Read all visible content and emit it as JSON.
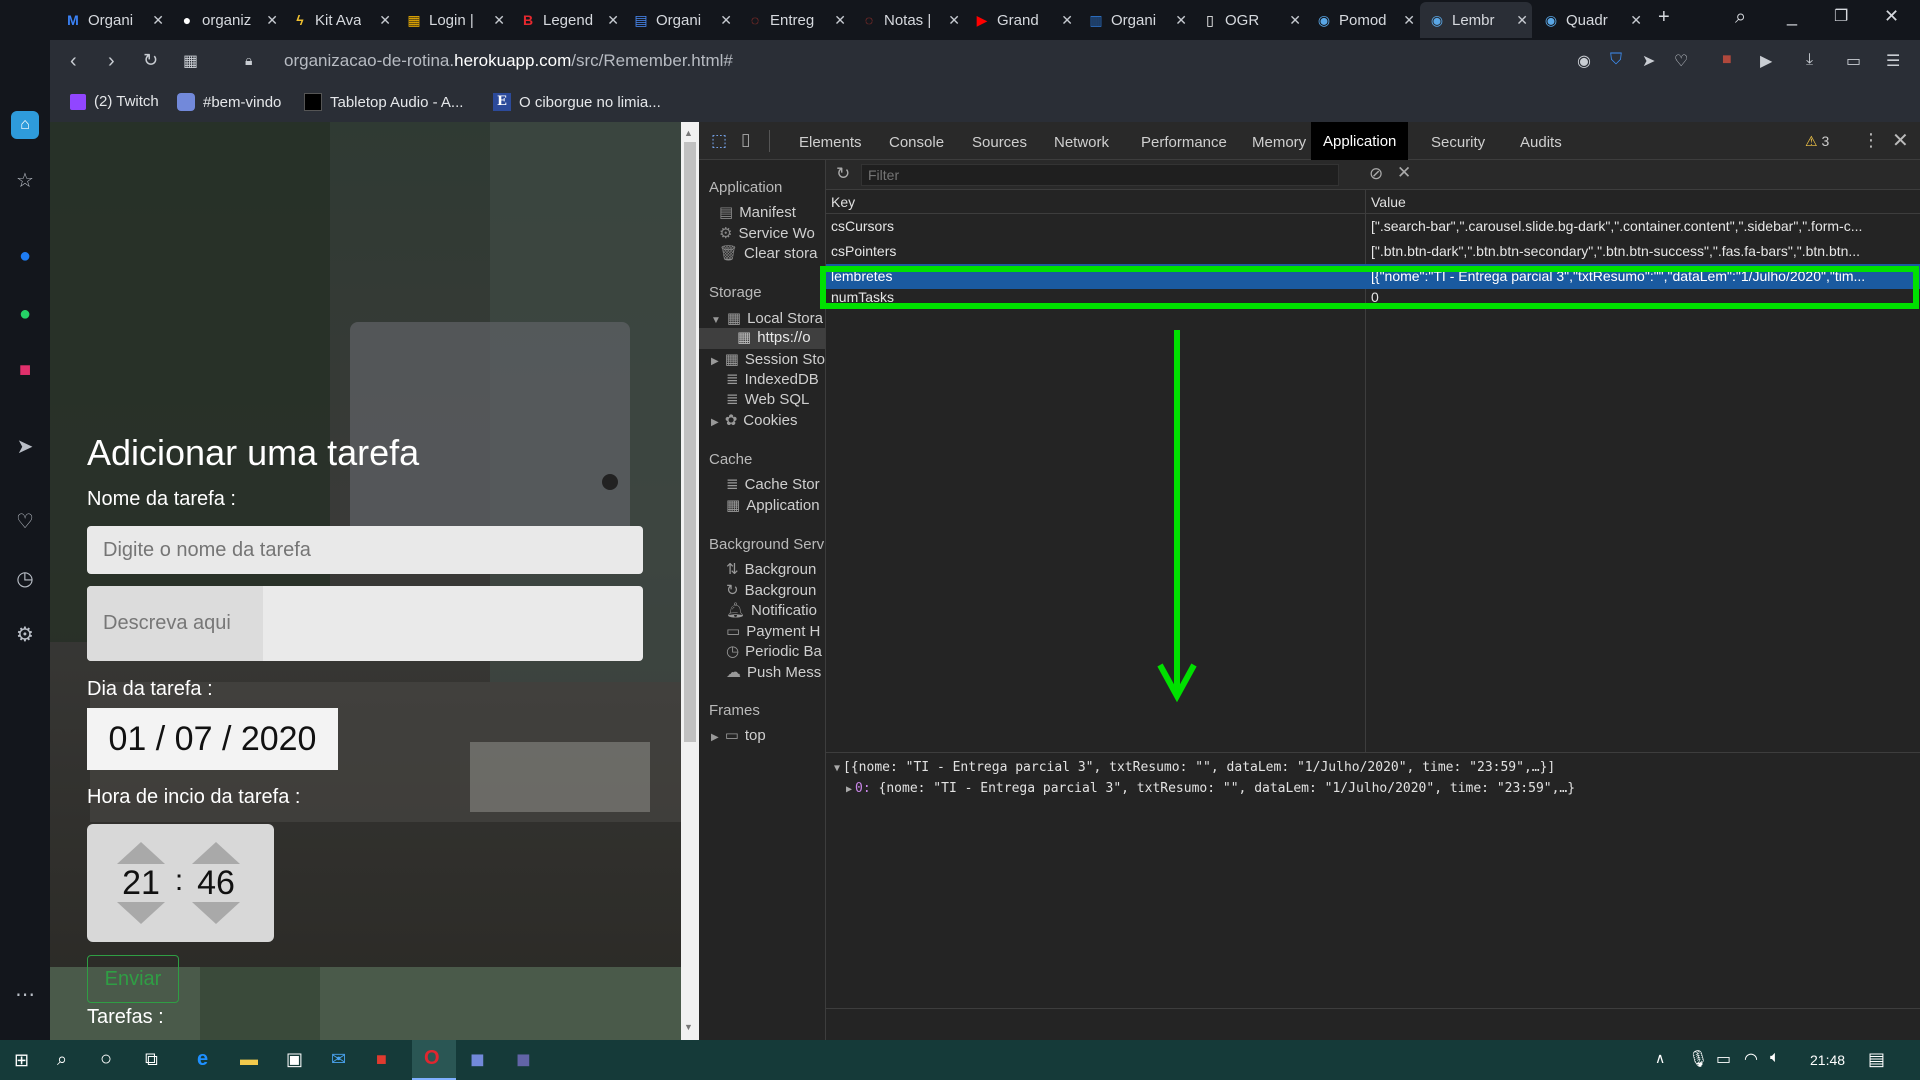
{
  "tabs": [
    {
      "label": "Organi",
      "icon": "M"
    },
    {
      "label": "organiz",
      "icon": "github"
    },
    {
      "label": "Kit Ava",
      "icon": "bolt"
    },
    {
      "label": "Login |",
      "icon": "grid"
    },
    {
      "label": "Legend",
      "icon": "B"
    },
    {
      "label": "Organi",
      "icon": "doc"
    },
    {
      "label": "Entreg",
      "icon": "ring"
    },
    {
      "label": "Notas |",
      "icon": "ring"
    },
    {
      "label": "Grand",
      "icon": "yt"
    },
    {
      "label": "Organi",
      "icon": "trello"
    },
    {
      "label": "OGR",
      "icon": "file"
    },
    {
      "label": "Pomod",
      "icon": "bird"
    },
    {
      "label": "Lembr",
      "icon": "bird"
    },
    {
      "label": "Quadr",
      "icon": "bird"
    }
  ],
  "address": {
    "url_prefix": "organizacao-de-rotina.",
    "url_host": "herokuapp.com",
    "url_path": "/src/Remember.html#"
  },
  "bookmarks": [
    {
      "label": "(2) Twitch",
      "icon": "twitch-icon"
    },
    {
      "label": "#bem-vindo",
      "icon": "discord-icon"
    },
    {
      "label": "Tabletop Audio - A...",
      "icon": "tabletop-icon"
    },
    {
      "label": "O ciborgue no limia...",
      "icon": "e-icon"
    }
  ],
  "page": {
    "heading": "Adicionar uma tarefa",
    "name_label": "Nome da tarefa :",
    "name_placeholder": "Digite o nome da tarefa",
    "desc_placeholder": "Descreva aqui",
    "date_label": "Dia da tarefa :",
    "date_value": "01 / 07 / 2020",
    "time_label": "Hora de incio da tarefa :",
    "time_hour": "21",
    "time_sep": ":",
    "time_min": "46",
    "submit_label": "Enviar",
    "tasks_label": "Tarefas :"
  },
  "devtools": {
    "tabs": [
      "Elements",
      "Console",
      "Sources",
      "Network",
      "Performance",
      "Memory",
      "Application",
      "Security",
      "Audits"
    ],
    "active_tab": "Application",
    "warnings": "3",
    "filter_placeholder": "Filter",
    "sidebar": {
      "app_header": "Application",
      "app_items": [
        "Manifest",
        "Service Wo",
        "Clear stora"
      ],
      "storage_header": "Storage",
      "storage_items": [
        "Local Stora",
        "https://o",
        "Session Sto",
        "IndexedDB",
        "Web SQL",
        "Cookies"
      ],
      "cache_header": "Cache",
      "cache_items": [
        "Cache Stor",
        "Application"
      ],
      "bg_header": "Background Servi",
      "bg_items": [
        "Backgroun",
        "Backgroun",
        "Notificatio",
        "Payment H",
        "Periodic Ba",
        "Push Mess"
      ],
      "frames_header": "Frames",
      "frames_items": [
        "top"
      ]
    },
    "table": {
      "headers": [
        "Key",
        "Value"
      ],
      "rows": [
        {
          "key": "csCursors",
          "value": "[\".search-bar\",\".carousel.slide.bg-dark\",\".container.content\",\".sidebar\",\".form-c..."
        },
        {
          "key": "csPointers",
          "value": "[\".btn.btn-dark\",\".btn.btn-secondary\",\".btn.btn-success\",\".fas.fa-bars\",\".btn.btn..."
        },
        {
          "key": "lembretes",
          "value": "[{\"nome\":\"TI - Entrega parcial 3\",\"txtResumo\":\"\",\"dataLem\":\"1/Julho/2020\",\"tim..."
        },
        {
          "key": "numTasks",
          "value": "0"
        }
      ]
    },
    "preview": {
      "line1": "[{nome: \"TI - Entrega parcial 3\", txtResumo: \"\", dataLem: \"1/Julho/2020\", time: \"23:59\",…}]",
      "line2_index": "0:",
      "line2": "{nome: \"TI - Entrega parcial 3\", txtResumo: \"\", dataLem: \"1/Julho/2020\", time: \"23:59\",…}"
    },
    "highlight_color": "#00e000"
  },
  "taskbar": {
    "time": "21:48"
  }
}
